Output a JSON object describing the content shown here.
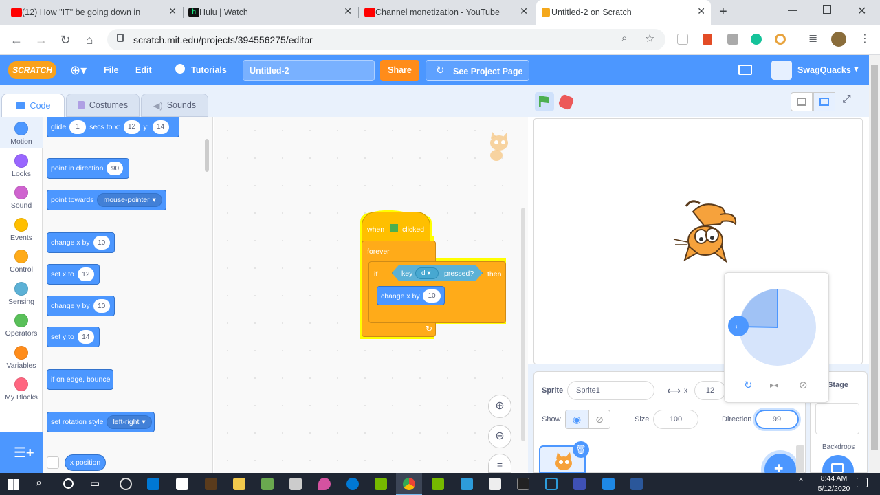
{
  "browser": {
    "tabs": [
      {
        "label": "(12) How \"IT\" be going down in",
        "color": "#ff0000"
      },
      {
        "label": "Hulu | Watch",
        "color": "#1ce783"
      },
      {
        "label": "Channel monetization - YouTube",
        "color": "#ff0000"
      },
      {
        "label": "Untitled-2 on Scratch",
        "color": "#f4a81c"
      }
    ],
    "new_tab": "+",
    "url": "scratch.mit.edu/projects/394556275/editor"
  },
  "menubar": {
    "logo": "SCRATCH",
    "file": "File",
    "edit": "Edit",
    "tutorials": "Tutorials",
    "project_title": "Untitled-2",
    "share": "Share",
    "see_project_page": "See Project Page",
    "username": "SwagQuacks"
  },
  "editor_tabs": {
    "code": "Code",
    "costumes": "Costumes",
    "sounds": "Sounds"
  },
  "categories": [
    {
      "label": "Motion",
      "color": "#4c97ff"
    },
    {
      "label": "Looks",
      "color": "#9966ff"
    },
    {
      "label": "Sound",
      "color": "#cf63cf"
    },
    {
      "label": "Events",
      "color": "#ffbf00"
    },
    {
      "label": "Control",
      "color": "#ffab19"
    },
    {
      "label": "Sensing",
      "color": "#5cb1d6"
    },
    {
      "label": "Operators",
      "color": "#59c059"
    },
    {
      "label": "Variables",
      "color": "#ff8c1a"
    },
    {
      "label": "My Blocks",
      "color": "#ff6680"
    }
  ],
  "palette": {
    "glide": {
      "t1": "glide",
      "v1": "1",
      "t2": "secs to x:",
      "v2": "12",
      "t3": "y:",
      "v3": "14"
    },
    "point_dir": {
      "t1": "point in direction",
      "v1": "90"
    },
    "point_towards": {
      "t1": "point towards",
      "v1": "mouse-pointer"
    },
    "change_x": {
      "t1": "change x by",
      "v1": "10"
    },
    "set_x": {
      "t1": "set x to",
      "v1": "12"
    },
    "change_y": {
      "t1": "change y by",
      "v1": "10"
    },
    "set_y": {
      "t1": "set y to",
      "v1": "14"
    },
    "bounce": {
      "t1": "if on edge, bounce"
    },
    "rotation": {
      "t1": "set rotation style",
      "v1": "left-right"
    },
    "xpos": {
      "t1": "x position"
    }
  },
  "script": {
    "when": "when",
    "clicked": "clicked",
    "forever": "forever",
    "if": "if",
    "key": "key",
    "key_val": "d",
    "pressed": "pressed?",
    "then": "then",
    "change": "change x by",
    "change_val": "10"
  },
  "sprite_info": {
    "sprite_label": "Sprite",
    "sprite_name": "Sprite1",
    "x_label": "x",
    "x_val": "12",
    "show_label": "Show",
    "size_label": "Size",
    "size_val": "100",
    "direction_label": "Direction",
    "direction_val": "99"
  },
  "stage_panel": {
    "stage_label": "Stage",
    "backdrops_label": "Backdrops"
  },
  "taskbar": {
    "time": "8:44 AM",
    "date": "5/12/2020"
  }
}
